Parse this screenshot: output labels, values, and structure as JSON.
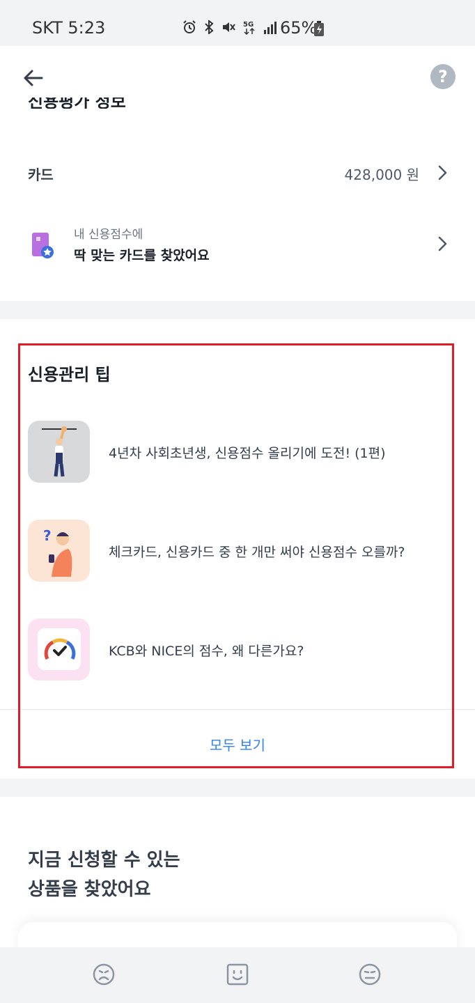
{
  "status_bar": {
    "carrier_time": "SKT 5:23",
    "battery": "65%",
    "icons": [
      "alarm-icon",
      "bluetooth-icon",
      "mute-icon",
      "5g-icon",
      "signal-icon",
      "battery-icon"
    ]
  },
  "header": {
    "back_icon": "back-arrow-icon",
    "help_label": "?",
    "cut_title": "신용평가 정보"
  },
  "card_row": {
    "label": "카드",
    "amount": "428,000 원"
  },
  "promo": {
    "subtitle": "내 신용점수에",
    "title": "딱 맞는 카드를 찾았어요"
  },
  "tips": {
    "title": "신용관리 팁",
    "items": [
      {
        "text": "4년차 사회초년생, 신용점수 올리기에 도전! (1편)"
      },
      {
        "text": "체크카드, 신용카드 중 한 개만 써야 신용점수 오를까?"
      },
      {
        "text": "KCB와 NICE의 점수, 왜 다른가요?"
      }
    ],
    "see_all": "모두 보기"
  },
  "products": {
    "title_line1": "지금 신청할 수 있는",
    "title_line2": "상품을 찾았어요"
  },
  "colors": {
    "accent": "#3182f6",
    "highlight": "#e01c26",
    "section_gap": "#f2f4f6"
  }
}
